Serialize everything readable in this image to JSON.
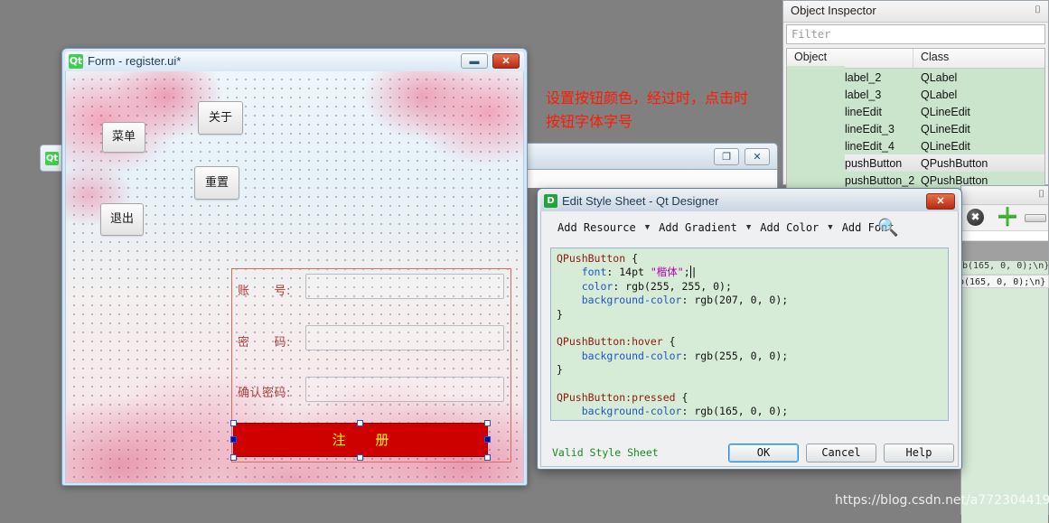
{
  "form_window": {
    "title": "Form - register.ui*",
    "logo": "qt-logo",
    "minimize": "▬",
    "close": "✕",
    "buttons": {
      "menu": "菜单",
      "about": "关于",
      "reset": "重置",
      "exit": "退出",
      "register": "注 册"
    },
    "labels": {
      "account": "账　　号:",
      "password": "密　　码:",
      "confirm": "确认密码:"
    },
    "line_edits": {
      "account_value": "",
      "password_value": "",
      "confirm_value": ""
    }
  },
  "background_window": {
    "logo": "Qt",
    "restore": "❐",
    "close": "✕"
  },
  "object_inspector": {
    "title": "Object Inspector",
    "float_icon": "⌷",
    "filter_placeholder": "Filter",
    "columns": [
      "Object",
      "Class"
    ],
    "rows": [
      {
        "object": "label_2",
        "class": "QLabel"
      },
      {
        "object": "label_3",
        "class": "QLabel"
      },
      {
        "object": "lineEdit",
        "class": "QLineEdit"
      },
      {
        "object": "lineEdit_3",
        "class": "QLineEdit"
      },
      {
        "object": "lineEdit_4",
        "class": "QLineEdit"
      },
      {
        "object": "pushButton",
        "class": "QPushButton"
      },
      {
        "object": "pushButton_2",
        "class": "QPushButton"
      }
    ]
  },
  "property_editor": {
    "float_icon": "⌷",
    "clear_icon": "✖",
    "add_icon": "＋",
    "remove_icon": "remove-icon",
    "code_fragment": "b(165, 0, 0);\\n}"
  },
  "style_sheet_dialog": {
    "title": "Edit Style Sheet - Qt Designer",
    "logo": "D",
    "close": "✕",
    "toolbar": {
      "add_resource": "Add Resource",
      "add_gradient": "Add Gradient",
      "add_color": "Add Color",
      "add_font": "Add Font",
      "caret": "▼",
      "search_icon": "🔍"
    },
    "code": {
      "lines": [
        {
          "parts": [
            {
              "t": "QPushButton",
              "c": "tok-sel"
            },
            {
              "t": " {",
              "c": "tok-punct"
            }
          ]
        },
        {
          "parts": [
            {
              "t": "    ",
              "c": "tok-punct"
            },
            {
              "t": "font",
              "c": "tok-prop"
            },
            {
              "t": ": 14pt ",
              "c": "tok-val"
            },
            {
              "t": "\"楷体\"",
              "c": "tok-str"
            },
            {
              "t": ";",
              "c": "tok-val"
            },
            {
              "t": "|",
              "c": "caret-bar"
            }
          ]
        },
        {
          "parts": [
            {
              "t": "    ",
              "c": "tok-punct"
            },
            {
              "t": "color",
              "c": "tok-prop"
            },
            {
              "t": ": rgb(255, 255, 0);",
              "c": "tok-val"
            }
          ]
        },
        {
          "parts": [
            {
              "t": "    ",
              "c": "tok-punct"
            },
            {
              "t": "background-color",
              "c": "tok-prop"
            },
            {
              "t": ": rgb(207, 0, 0);",
              "c": "tok-val"
            }
          ]
        },
        {
          "parts": [
            {
              "t": "}",
              "c": "tok-punct"
            }
          ]
        },
        {
          "parts": [
            {
              "t": "",
              "c": "tok-punct"
            }
          ]
        },
        {
          "parts": [
            {
              "t": "QPushButton:hover",
              "c": "tok-sel"
            },
            {
              "t": " {",
              "c": "tok-punct"
            }
          ]
        },
        {
          "parts": [
            {
              "t": "    ",
              "c": "tok-punct"
            },
            {
              "t": "background-color",
              "c": "tok-prop"
            },
            {
              "t": ": rgb(255, 0, 0);",
              "c": "tok-val"
            }
          ]
        },
        {
          "parts": [
            {
              "t": "}",
              "c": "tok-punct"
            }
          ]
        },
        {
          "parts": [
            {
              "t": "",
              "c": "tok-punct"
            }
          ]
        },
        {
          "parts": [
            {
              "t": "QPushButton:pressed",
              "c": "tok-sel"
            },
            {
              "t": " {",
              "c": "tok-punct"
            }
          ]
        },
        {
          "parts": [
            {
              "t": "    ",
              "c": "tok-punct"
            },
            {
              "t": "background-color",
              "c": "tok-prop"
            },
            {
              "t": ": rgb(165, 0, 0);",
              "c": "tok-val"
            }
          ]
        },
        {
          "parts": [
            {
              "t": "}",
              "c": "tok-punct"
            }
          ]
        }
      ]
    },
    "status": "Valid Style Sheet",
    "buttons": {
      "ok": "OK",
      "cancel": "Cancel",
      "help": "Help"
    }
  },
  "annotation": {
    "line1": "设置按钮颜色，经过时，点击时",
    "line2": "按钮字体字号",
    "color": "#ff1a00"
  },
  "watermark": {
    "text": "https://blog.csdn.net/a772304419"
  },
  "colors": {
    "register_background": "#cf0000",
    "register_text": "#ffff00",
    "selection_handle": "#2b4fd8",
    "inspector_row": "#cbe5cd",
    "editor_background": "#d6ecd6",
    "status_text": "#1a8a1a"
  }
}
